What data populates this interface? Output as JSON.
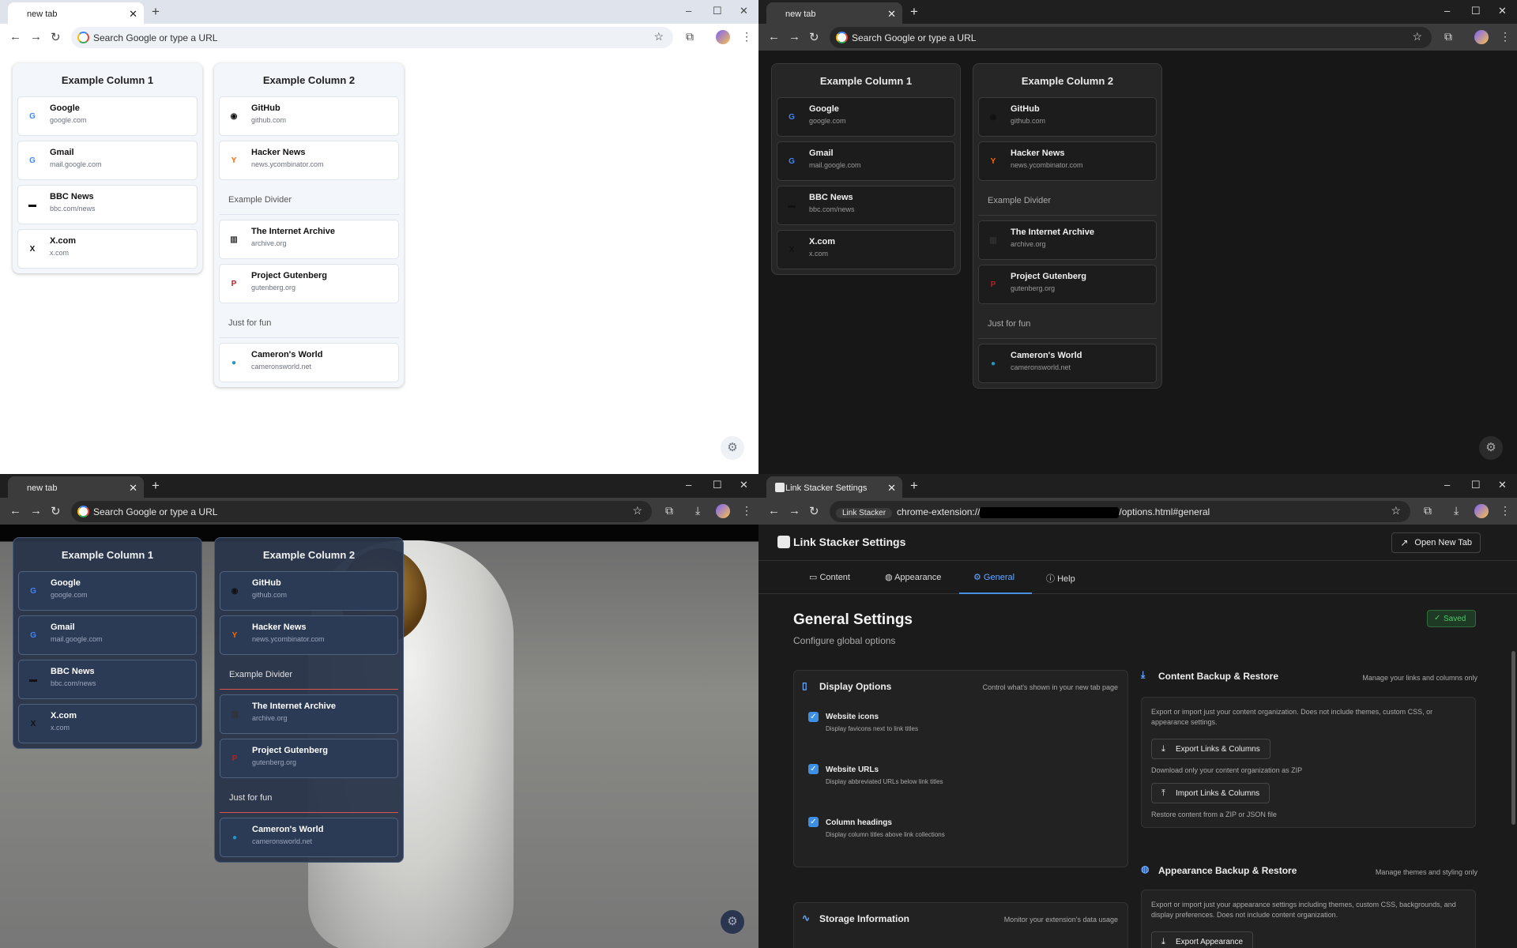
{
  "browser": {
    "search_placeholder": "Search Google or type a URL",
    "new_tab_symbol": "+",
    "window_min": "–",
    "window_max": "☐",
    "window_close": "✕"
  },
  "newtab": {
    "tab_title": "new tab",
    "columns": [
      {
        "heading": "Example Column 1",
        "items": [
          {
            "type": "link",
            "title": "Google",
            "url": "google.com",
            "icon": "G",
            "icon_color": "#4285f4"
          },
          {
            "type": "link",
            "title": "Gmail",
            "url": "mail.google.com",
            "icon": "G",
            "icon_color": "#4285f4"
          },
          {
            "type": "link",
            "title": "BBC News",
            "url": "bbc.com/news",
            "icon": "▬",
            "icon_color": "#111111"
          },
          {
            "type": "link",
            "title": "X.com",
            "url": "x.com",
            "icon": "X",
            "icon_color": "#111111"
          }
        ]
      },
      {
        "heading": "Example Column 2",
        "items": [
          {
            "type": "link",
            "title": "GitHub",
            "url": "github.com",
            "icon": "◉",
            "icon_color": "#111111"
          },
          {
            "type": "link",
            "title": "Hacker News",
            "url": "news.ycombinator.com",
            "icon": "Y",
            "icon_color": "#ff6600"
          },
          {
            "type": "divider",
            "title": "Example Divider"
          },
          {
            "type": "link",
            "title": "The Internet Archive",
            "url": "archive.org",
            "icon": "▥",
            "icon_color": "#333333"
          },
          {
            "type": "link",
            "title": "Project Gutenberg",
            "url": "gutenberg.org",
            "icon": "P",
            "icon_color": "#b22222"
          },
          {
            "type": "divider",
            "title": "Just for fun"
          },
          {
            "type": "link",
            "title": "Cameron's World",
            "url": "cameronsworld.net",
            "icon": "●",
            "icon_color": "#1a9ac9"
          }
        ]
      }
    ]
  },
  "settings": {
    "tab_title": "Link Stacker Settings",
    "address_chip": "Link Stacker",
    "address_prefix": "chrome-extension://",
    "address_suffix": "/options.html#general",
    "app_title": "Link Stacker Settings",
    "open_new_tab": "Open New Tab",
    "tabs": [
      "Content",
      "Appearance",
      "General",
      "Help"
    ],
    "active_tab": "General",
    "heading": "General Settings",
    "subheading": "Configure global options",
    "saved_label": "Saved",
    "display_options": {
      "title": "Display Options",
      "note": "Control what's shown in your new tab page",
      "options": [
        {
          "label": "Website icons",
          "desc": "Display favicons next to link titles",
          "checked": true
        },
        {
          "label": "Website URLs",
          "desc": "Display abbreviated URLs below link titles",
          "checked": true
        },
        {
          "label": "Column headings",
          "desc": "Display column titles above link collections",
          "checked": true
        }
      ]
    },
    "content_backup": {
      "title": "Content Backup & Restore",
      "note": "Manage your links and columns only",
      "desc": "Export or import just your content organization. Does not include themes, custom CSS, or appearance settings.",
      "export_label": "Export Links & Columns",
      "export_desc": "Download only your content organization as ZIP",
      "import_label": "Import Links & Columns",
      "import_desc": "Restore content from a ZIP or JSON file"
    },
    "appearance_backup": {
      "title": "Appearance Backup & Restore",
      "note": "Manage themes and styling only",
      "desc": "Export or import just your appearance settings including themes, custom CSS, backgrounds, and display preferences. Does not include content organization.",
      "export_label": "Export Appearance"
    },
    "storage": {
      "title": "Storage Information",
      "note": "Monitor your extension's data usage"
    }
  }
}
